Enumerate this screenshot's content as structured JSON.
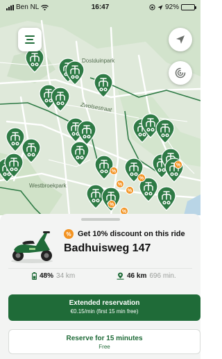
{
  "status_bar": {
    "carrier": "Ben NL",
    "time": "16:47",
    "battery": "92%"
  },
  "map": {
    "labels": {
      "park_1": "Dostduinpark",
      "street_1": "Zwolsestraat",
      "park_2": "Westbroekpark"
    }
  },
  "sheet": {
    "discount_text": "Get 10% discount on this ride",
    "discount_badge": "%",
    "address": "Badhuisweg 147",
    "battery_pct": "48%",
    "battery_range": "34 km",
    "walk_distance": "46 km",
    "walk_time": "696 min.",
    "primary": {
      "title": "Extended reservation",
      "subtitle": "€0.15/min (first 15 min free)"
    },
    "secondary": {
      "title": "Reserve for 15 minutes",
      "subtitle": "Free"
    }
  },
  "colors": {
    "brand": "#1f6b38",
    "marker": "#2e7a45",
    "discount": "#f39321"
  }
}
